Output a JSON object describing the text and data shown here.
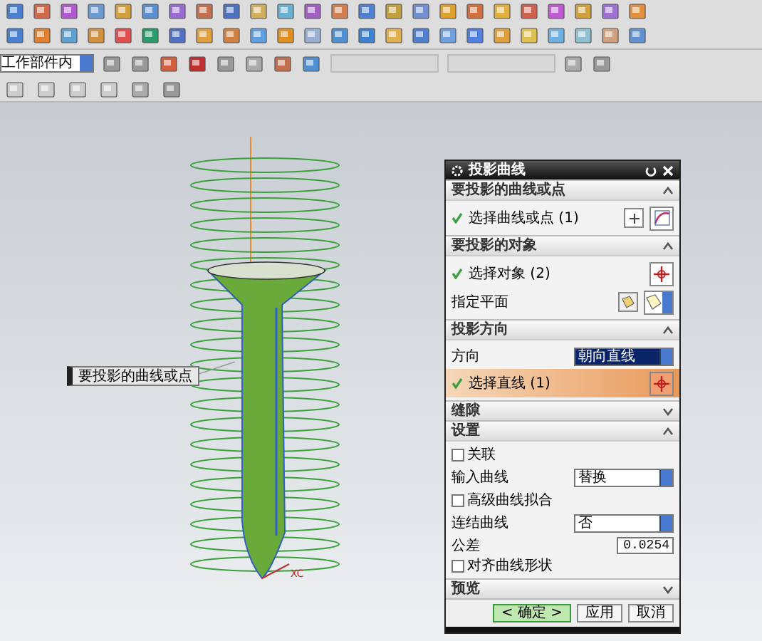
{
  "toolbar": {
    "filter_dropdown": {
      "value": "工作部件内"
    }
  },
  "callout": {
    "label": "要投影的曲线或点"
  },
  "axis_label": "XC",
  "dialog": {
    "title": "投影曲线",
    "sections": [
      {
        "title": "要投影的曲线或点",
        "expanded": true,
        "rows": [
          {
            "kind": "curve_selection",
            "label": "选择曲线或点 (1)",
            "active": false
          }
        ]
      },
      {
        "title": "要投影的对象",
        "expanded": true,
        "rows": [
          {
            "kind": "selection",
            "label": "选择对象 (2)",
            "active": false
          },
          {
            "kind": "plane",
            "label": "指定平面"
          }
        ]
      },
      {
        "title": "投影方向",
        "expanded": true,
        "rows": [
          {
            "kind": "dropdown",
            "label": "方向",
            "value": "朝向直线",
            "focused": true
          },
          {
            "kind": "selection",
            "label": "选择直线 (1)",
            "active": true
          }
        ]
      },
      {
        "title": "缝隙",
        "expanded": false
      },
      {
        "title": "设置",
        "expanded": true,
        "rows": [
          {
            "kind": "checkbox",
            "label": "关联",
            "checked": false
          },
          {
            "kind": "dropdown",
            "label": "输入曲线",
            "value": "替换",
            "focused": false
          },
          {
            "kind": "checkbox",
            "label": "高级曲线拟合",
            "checked": false
          },
          {
            "kind": "dropdown",
            "label": "连结曲线",
            "value": "否",
            "focused": false
          },
          {
            "kind": "number",
            "label": "公差",
            "value": "0.0254"
          },
          {
            "kind": "checkbox",
            "label": "对齐曲线形状",
            "checked": false
          }
        ]
      },
      {
        "title": "预览",
        "expanded": false
      }
    ],
    "buttons": [
      {
        "label": "< 确定 >",
        "default": true
      },
      {
        "label": "应用",
        "default": false
      },
      {
        "label": "取消",
        "default": false
      }
    ]
  }
}
